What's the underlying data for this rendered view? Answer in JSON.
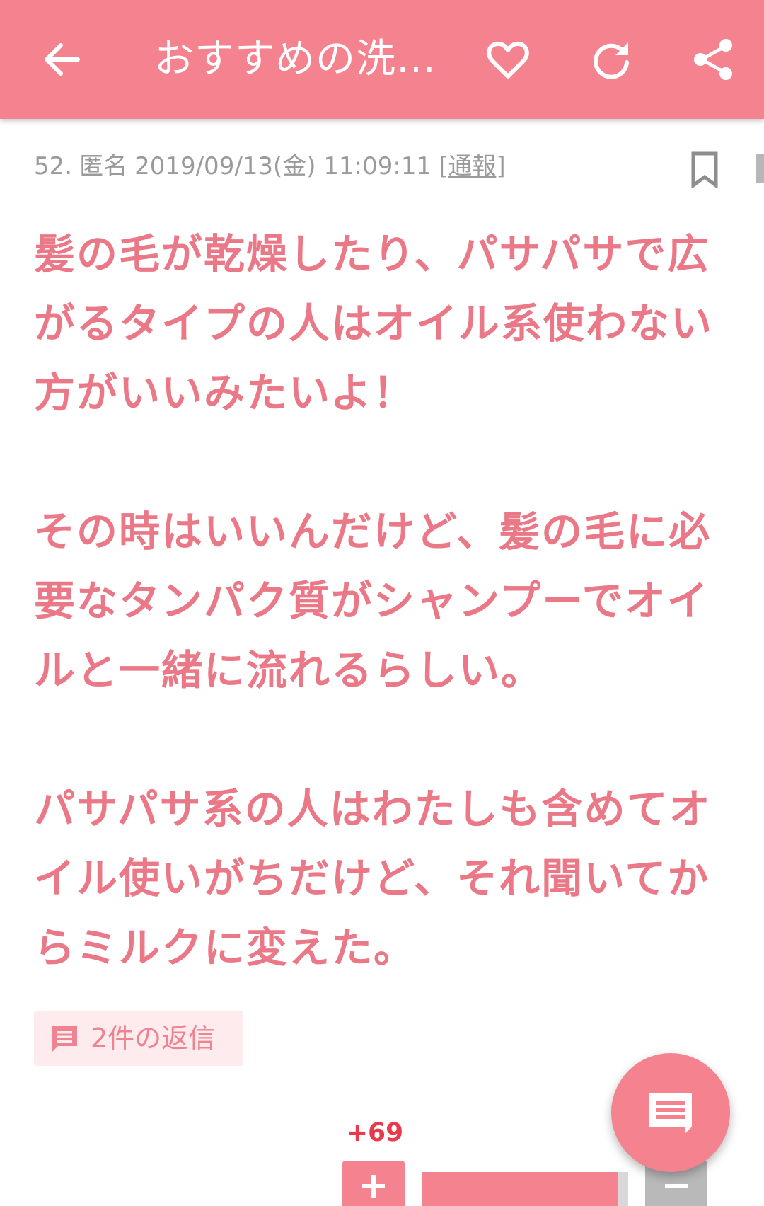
{
  "app_bar": {
    "title": "おすすめの洗…",
    "icons": [
      "back-arrow-icon",
      "heart-icon",
      "refresh-icon",
      "share-icon"
    ]
  },
  "post": {
    "number": "52.",
    "author": "匿名",
    "datetime": "2019/09/13(金) 11:09:11",
    "report_label": "通報",
    "paragraphs": [
      [
        "髪の毛が乾燥したり、パサパサで広",
        "がるタイプの人はオイル系使わない",
        "方がいいみたいよ！"
      ],
      [
        "その時はいいんだけど、髪の毛に必",
        "要なタンパク質がシャンプーでオイ",
        "ルと一緒に流れるらしい。"
      ],
      [
        "パサパサ系の人はわたしも含めてオ",
        "イル使いがちだけど、それ聞いてか",
        "らミルクに変えた。"
      ]
    ],
    "replies_label": "2件の返信"
  },
  "vote": {
    "count": "+69",
    "plus_share": 0.95
  },
  "colors": {
    "primary": "#f4838f",
    "body_text": "#ea7887",
    "meta_text": "#9a9a9a",
    "vote_count": "#e9394d",
    "chip_bg": "#fdebed",
    "minus_bg": "#b9b9b9"
  }
}
